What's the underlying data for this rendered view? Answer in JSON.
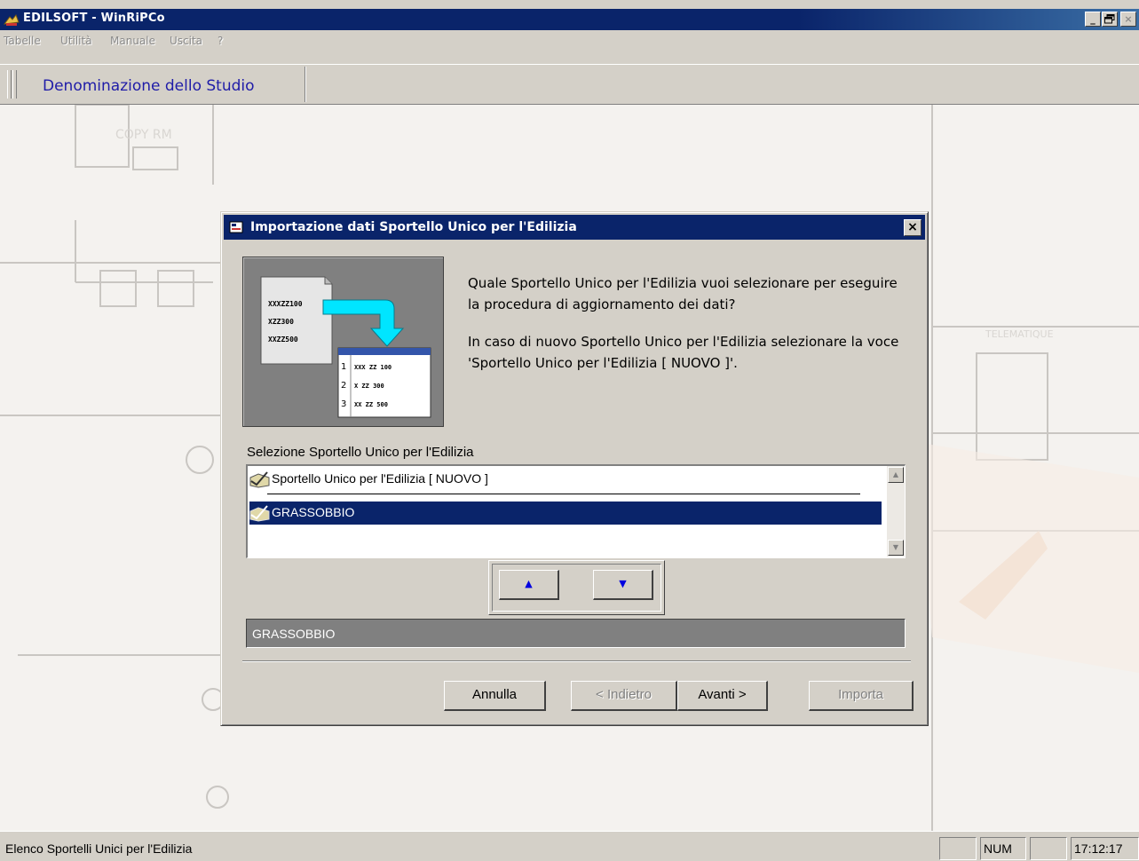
{
  "window": {
    "title": "EDILSOFT - WinRiPCo",
    "controls": {
      "minimize": "_",
      "maximize": "▫",
      "close": "×"
    }
  },
  "menu": {
    "items": [
      "Tabelle",
      "Utilità",
      "Manuale",
      "Uscita",
      "?"
    ]
  },
  "toolbar": {
    "studio_label": "Denominazione dello Studio"
  },
  "dialog": {
    "title": "Importazione dati Sportello Unico per l'Edilizia",
    "close_label": "×",
    "illustration": {
      "file_lines": [
        "XXXZZ100",
        "XZZ300",
        "XXZZ500"
      ],
      "table_rows": [
        {
          "num": "1",
          "text": "XXX  ZZ 100"
        },
        {
          "num": "2",
          "text": "X     ZZ 300"
        },
        {
          "num": "3",
          "text": "XX   ZZ 500"
        }
      ]
    },
    "message_1": "Quale Sportello Unico per l'Edilizia vuoi selezionare per eseguire la procedura di aggiornamento dei dati?",
    "message_2": "In caso di nuovo Sportello Unico per l'Edilizia selezionare la voce 'Sportello Unico per l'Edilizia [ NUOVO ]'.",
    "selection_label": "Selezione Sportello Unico per l'Edilizia",
    "list_items": [
      {
        "label": "Sportello Unico per l'Edilizia [ NUOVO ]",
        "selected": false
      },
      {
        "label": "GRASSOBBIO",
        "selected": true
      }
    ],
    "move_up_icon": "▲",
    "move_down_icon": "▼",
    "selected_value": "GRASSOBBIO",
    "buttons": {
      "cancel": "Annulla",
      "back": "< Indietro",
      "next": "Avanti >",
      "import": "Importa"
    }
  },
  "statusbar": {
    "text": "Elenco Sportelli Unici per l'Edilizia",
    "num": "NUM",
    "time": "17:12:17"
  },
  "colors": {
    "titlebar": "#0a246a",
    "face": "#d4d0c8",
    "selection": "#0a246a",
    "studio_text": "#1f1ca8",
    "arrow_cyan": "#00e5ff"
  }
}
